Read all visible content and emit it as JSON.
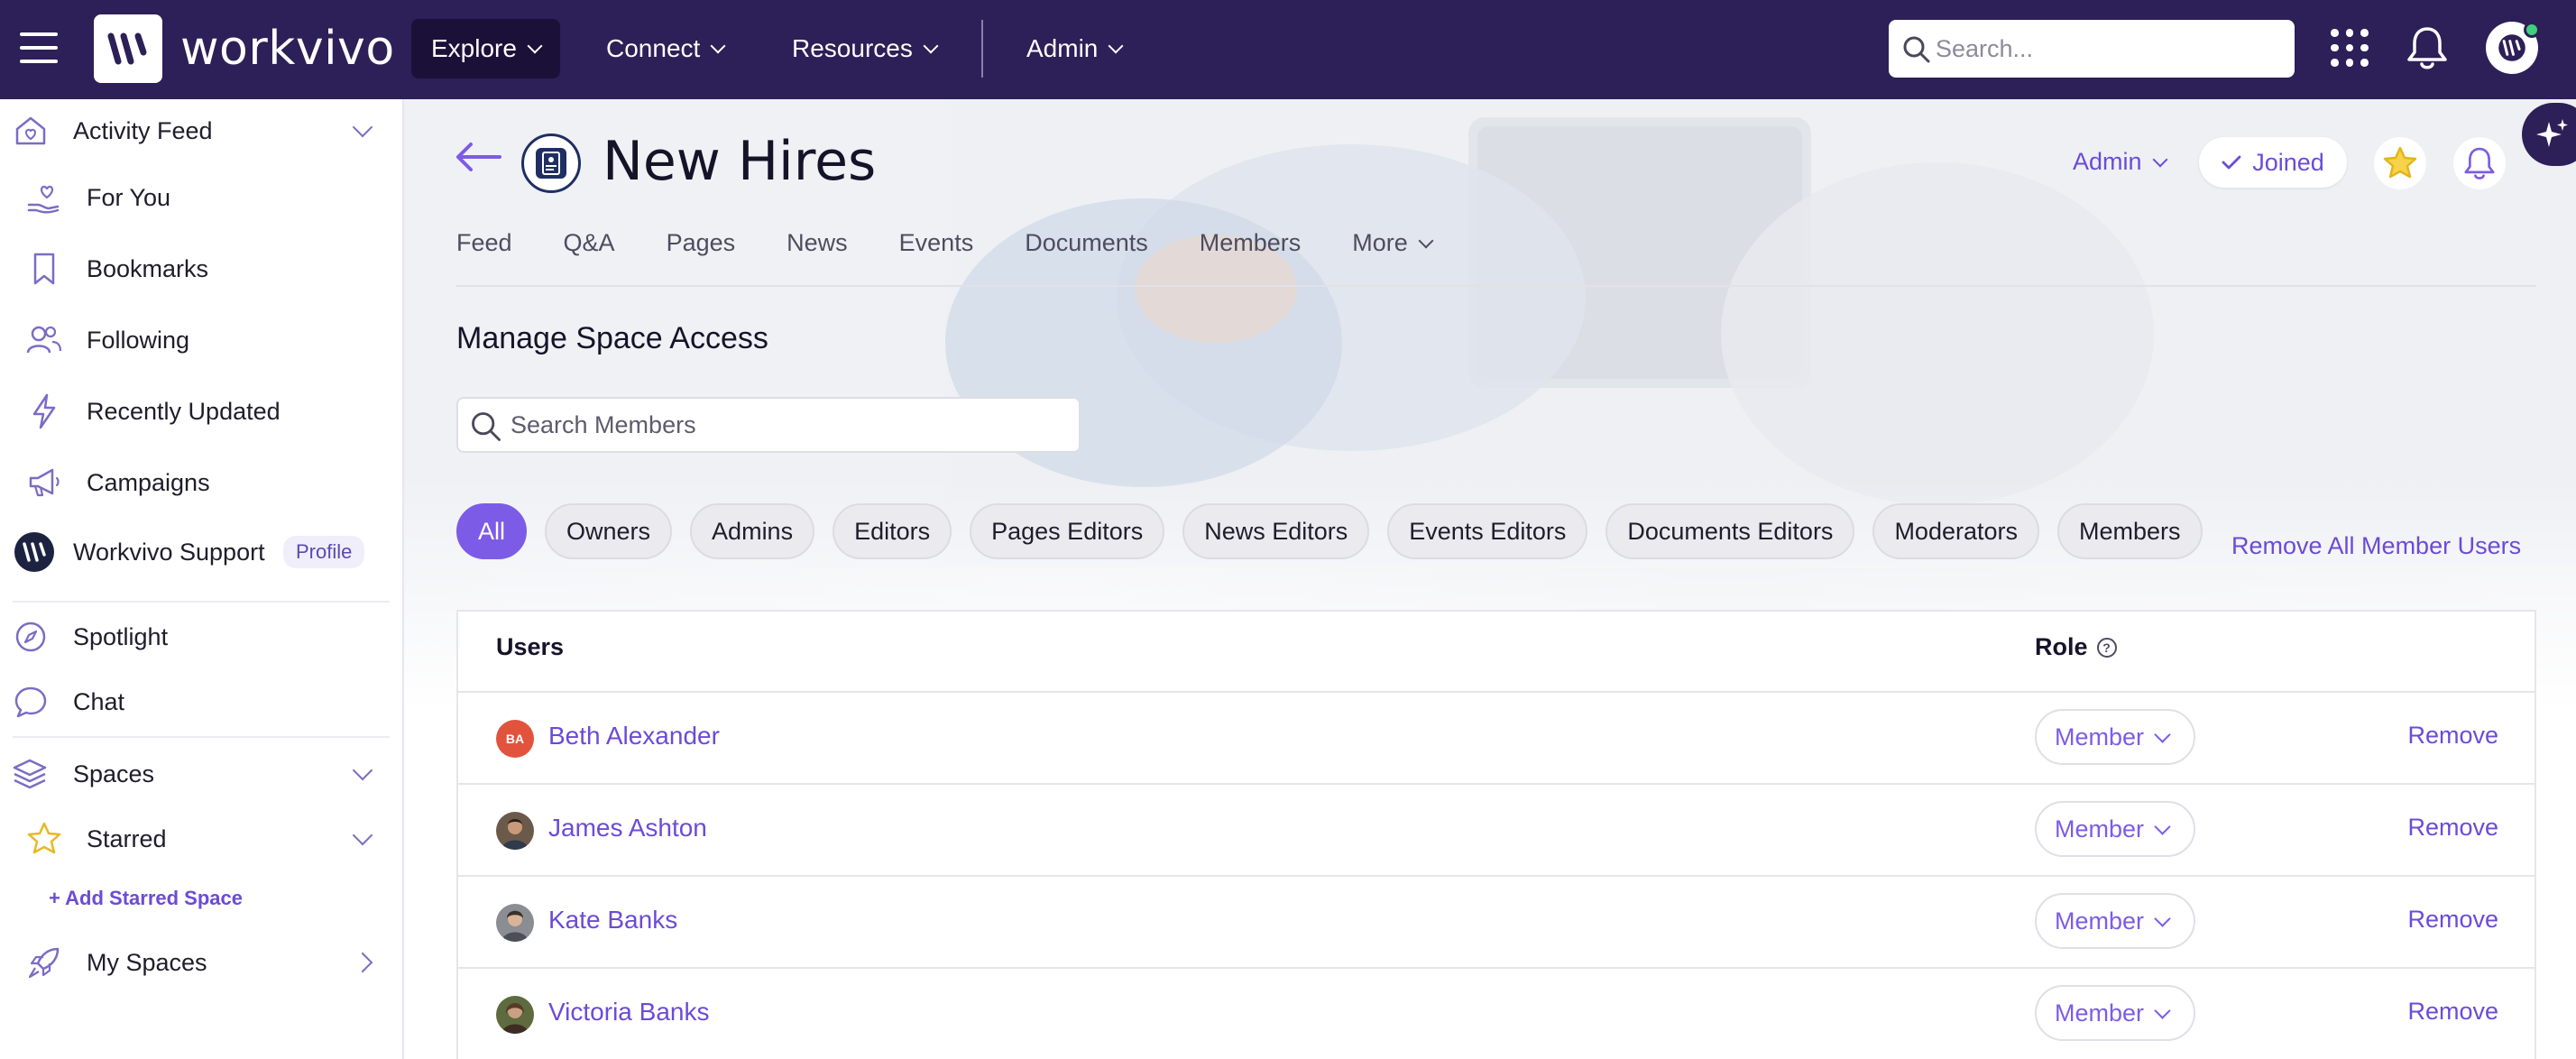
{
  "app": {
    "brand": "workvivo"
  },
  "topbar": {
    "nav": [
      {
        "label": "Explore"
      },
      {
        "label": "Connect"
      },
      {
        "label": "Resources"
      },
      {
        "label": "Admin"
      }
    ],
    "search_placeholder": "Search..."
  },
  "sidebar": {
    "items": [
      {
        "label": "Activity Feed"
      },
      {
        "label": "For You"
      },
      {
        "label": "Bookmarks"
      },
      {
        "label": "Following"
      },
      {
        "label": "Recently Updated"
      },
      {
        "label": "Campaigns"
      },
      {
        "label": "Workvivo Support",
        "badge": "Profile"
      },
      {
        "label": "Spotlight"
      },
      {
        "label": "Chat"
      },
      {
        "label": "Spaces"
      },
      {
        "label": "Starred"
      },
      {
        "label": "My Spaces"
      }
    ],
    "add_starred": "Add Starred Space"
  },
  "space": {
    "title": "New Hires",
    "admin_label": "Admin",
    "joined_label": "Joined",
    "tabs": [
      "Feed",
      "Q&A",
      "Pages",
      "News",
      "Events",
      "Documents",
      "Members",
      "More"
    ]
  },
  "access": {
    "title": "Manage Space Access",
    "search_placeholder": "Search Members",
    "filters": [
      "All",
      "Owners",
      "Admins",
      "Editors",
      "Pages Editors",
      "News Editors",
      "Events Editors",
      "Documents Editors",
      "Moderators",
      "Members"
    ],
    "active_filter": "All",
    "remove_all": "Remove All Member Users",
    "table": {
      "col_users": "Users",
      "col_role": "Role",
      "rows": [
        {
          "name": "Beth Alexander",
          "initials": "BA",
          "role": "Member",
          "action": "Remove"
        },
        {
          "name": "James Ashton",
          "role": "Member",
          "action": "Remove"
        },
        {
          "name": "Kate Banks",
          "role": "Member",
          "action": "Remove"
        },
        {
          "name": "Victoria Banks",
          "role": "Member",
          "action": "Remove"
        }
      ]
    }
  },
  "colors": {
    "topbar": "#2d1f57",
    "accent": "#6c4bd6",
    "chip_active": "#7c5ce6"
  }
}
